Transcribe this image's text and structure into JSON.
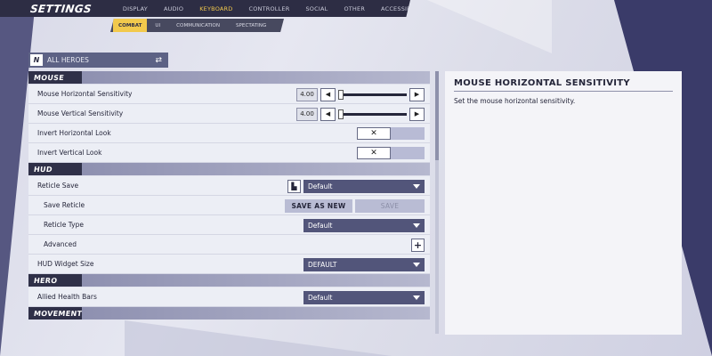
{
  "header": {
    "title": "SETTINGS",
    "tabs": [
      "DISPLAY",
      "AUDIO",
      "KEYBOARD",
      "CONTROLLER",
      "SOCIAL",
      "OTHER",
      "ACCESSIBILITY"
    ],
    "active_tab": "KEYBOARD"
  },
  "subtabs": {
    "items": [
      "COMBAT",
      "UI",
      "COMMUNICATION",
      "SPECTATING"
    ],
    "active": "COMBAT"
  },
  "hero_selector": {
    "label": "ALL HEROES"
  },
  "sections": {
    "mouse": {
      "title": "MOUSE",
      "horizontal_sensitivity": {
        "label": "Mouse Horizontal Sensitivity",
        "value": "4.00"
      },
      "vertical_sensitivity": {
        "label": "Mouse Vertical Sensitivity",
        "value": "4.00"
      },
      "invert_horizontal": {
        "label": "Invert Horizontal Look"
      },
      "invert_vertical": {
        "label": "Invert Vertical Look"
      }
    },
    "hud": {
      "title": "HUD",
      "reticle_save": {
        "label": "Reticle Save",
        "value": "Default"
      },
      "save_reticle": {
        "label": "Save Reticle",
        "save_as_new": "SAVE AS NEW",
        "save": "SAVE"
      },
      "reticle_type": {
        "label": "Reticle Type",
        "value": "Default"
      },
      "advanced": {
        "label": "Advanced"
      },
      "hud_widget_size": {
        "label": "HUD Widget Size",
        "value": "DEFAULT"
      }
    },
    "hero": {
      "title": "HERO",
      "allied_health_bars": {
        "label": "Allied Health Bars",
        "value": "Default"
      }
    },
    "movement": {
      "title": "MOVEMENT"
    }
  },
  "description": {
    "title": "MOUSE HORIZONTAL SENSITIVITY",
    "text": "Set the mouse horizontal sensitivity."
  },
  "glyphs": {
    "left_arrow": "◀",
    "right_arrow": "▶",
    "toggle_off": "✕",
    "plus": "+",
    "swap": "⇄",
    "hero_logo": "N",
    "save_icon": "▙"
  },
  "colors": {
    "accent": "#f2c94c",
    "nav_bg": "#2d2d44",
    "dropdown_bg": "#52557a"
  }
}
